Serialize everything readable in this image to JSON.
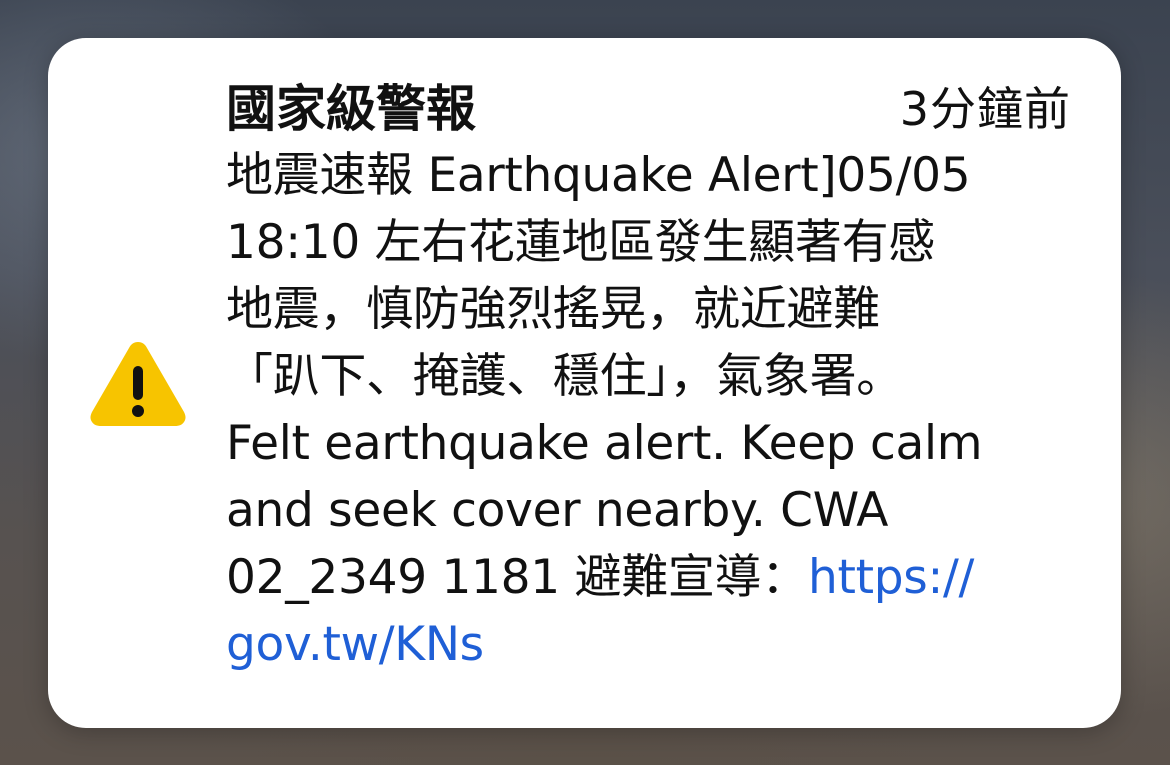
{
  "notification": {
    "title": "國家級警報",
    "time": "3分鐘前",
    "lines": [
      "地震速報 Earthquake Alert]05/05",
      "18:10 左右花蓮地區發生顯著有感",
      "地震，慎防強烈搖晃，就近避難",
      "「趴下、掩護、穩住」，氣象署。",
      "Felt earthquake alert. Keep calm",
      "and seek cover nearby. CWA"
    ],
    "line7_text": "02_2349 1181 避難宣導：",
    "link_part1": "https://",
    "link_part2": "gov.tw/KNs",
    "icon": "warning-triangle-icon"
  },
  "colors": {
    "card_background": "#ffffff",
    "text": "#111111",
    "link": "#1f5fd6",
    "warning_fill": "#f7c400"
  }
}
